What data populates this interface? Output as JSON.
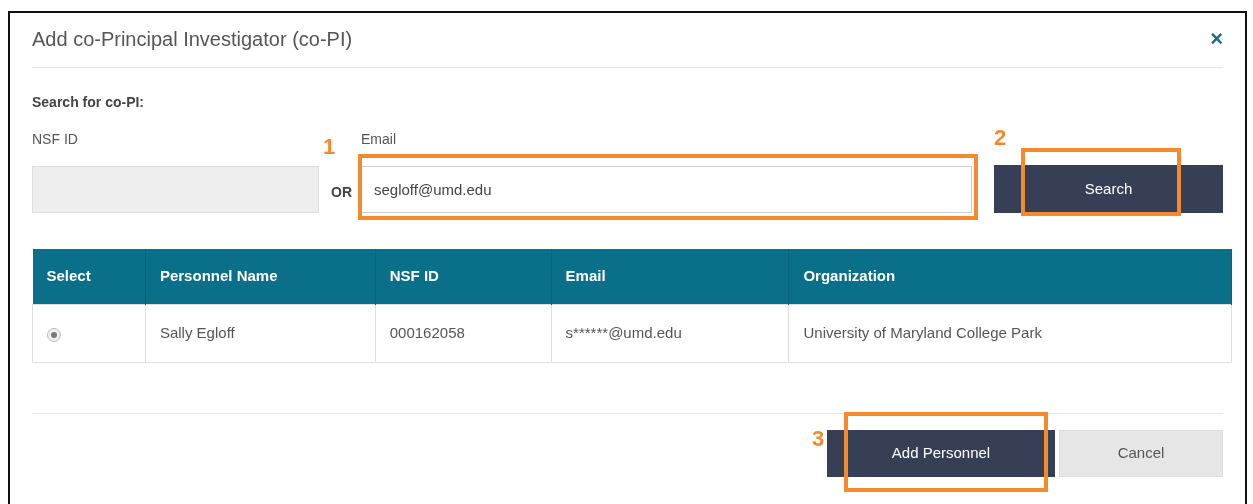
{
  "dialog": {
    "title": "Add co-Principal Investigator (co-PI)",
    "close": "×"
  },
  "search": {
    "heading": "Search for co-PI:",
    "nsf_label": "NSF ID",
    "or": "OR",
    "email_label": "Email",
    "email_value": "segloff@umd.edu",
    "email_callout": "1",
    "button": "Search",
    "button_callout": "2"
  },
  "table": {
    "columns": [
      "Select",
      "Personnel Name",
      "NSF ID",
      "Email",
      "Organization"
    ],
    "rows": [
      {
        "selected": true,
        "personnel_name": "Sally Egloff",
        "nsf_id": "000162058",
        "email": "s******@umd.edu",
        "organization": "University of Maryland College Park"
      }
    ]
  },
  "footer": {
    "add": "Add Personnel",
    "add_callout": "3",
    "cancel": "Cancel"
  }
}
